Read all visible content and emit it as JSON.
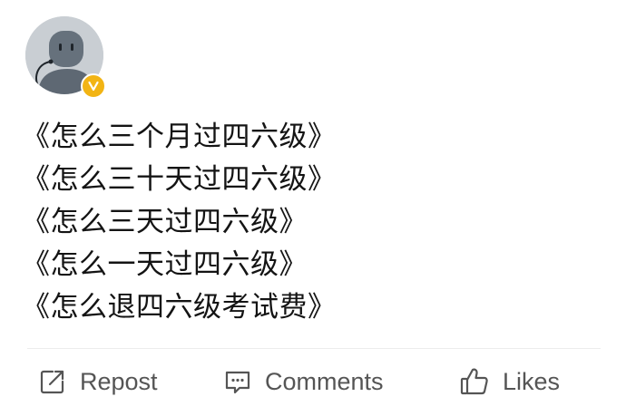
{
  "post": {
    "author": {
      "avatar_icon": "cartoon-avatar-icon",
      "verified_icon": "verified-v-icon",
      "verified_color": "#f2b414"
    },
    "lines": [
      "《怎么三个月过四六级》",
      "《怎么三十天过四六级》",
      "《怎么三天过四六级》",
      "《怎么一天过四六级》",
      "《怎么退四六级考试费》"
    ]
  },
  "actions": {
    "repost": {
      "icon": "repost-icon",
      "label": "Repost"
    },
    "comments": {
      "icon": "comment-icon",
      "label": "Comments"
    },
    "likes": {
      "icon": "thumbs-up-icon",
      "label": "Likes"
    }
  }
}
